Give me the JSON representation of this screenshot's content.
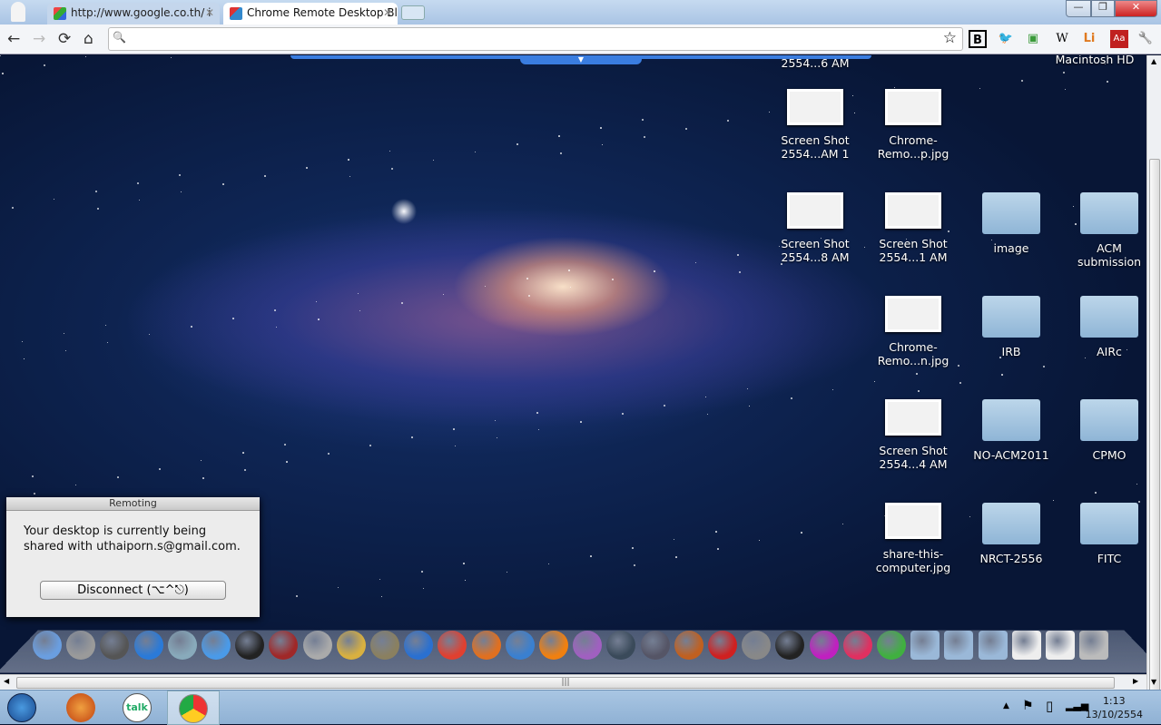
{
  "browser": {
    "tabs": [
      {
        "label": "http://www.google.co.th/ i",
        "favicon": "google-icon",
        "active": false
      },
      {
        "label": "Chrome Remote Desktop Bl",
        "favicon": "chrome-remote-desktop-icon",
        "active": true
      }
    ],
    "nav": {
      "back": "←",
      "forward": "→",
      "reload": "⟳",
      "home": "⌂"
    },
    "omnibox": {
      "value": "",
      "search_icon": "🔍",
      "star": "☆"
    },
    "extensions": [
      {
        "name": "b-icon",
        "glyph": "B",
        "color": "#000"
      },
      {
        "name": "twitter-icon",
        "glyph": "🐦",
        "color": "#3a8ad8"
      },
      {
        "name": "remote-desktop-icon",
        "glyph": "▣",
        "color": "#3a9a3a"
      },
      {
        "name": "wikipedia-icon",
        "glyph": "W",
        "color": "#222"
      },
      {
        "name": "li-icon",
        "glyph": "Li",
        "color": "#e07a20"
      },
      {
        "name": "dictionary-icon",
        "glyph": "Aa",
        "color": "#c02020"
      },
      {
        "name": "wrench-icon",
        "glyph": "🔧",
        "color": "#333"
      }
    ],
    "window_buttons": {
      "minimize": "—",
      "restore": "❐",
      "close": "✕"
    }
  },
  "desktop": {
    "remote_toggle": "▼",
    "partial_labels": {
      "top_screenshot": "2554...6 AM",
      "drive": "Macintosh HD"
    },
    "icons": [
      {
        "type": "thumb",
        "label1": "Screen Shot",
        "label2": "2554...AM 1",
        "col": 0,
        "row": 0
      },
      {
        "type": "thumb",
        "label1": "Chrome-",
        "label2": "Remo...p.jpg",
        "col": 1,
        "row": 0
      },
      {
        "type": "thumb",
        "label1": "Screen Shot",
        "label2": "2554...8 AM",
        "col": 0,
        "row": 1
      },
      {
        "type": "thumb",
        "label1": "Screen Shot",
        "label2": "2554...1 AM",
        "col": 1,
        "row": 1
      },
      {
        "type": "folder",
        "label1": "image",
        "label2": "",
        "col": 2,
        "row": 1
      },
      {
        "type": "folder",
        "label1": "ACM",
        "label2": "submission",
        "col": 3,
        "row": 1
      },
      {
        "type": "thumb",
        "label1": "Chrome-",
        "label2": "Remo...n.jpg",
        "col": 1,
        "row": 2
      },
      {
        "type": "folder",
        "label1": "IRB",
        "label2": "",
        "col": 2,
        "row": 2
      },
      {
        "type": "folder",
        "label1": "AIRc",
        "label2": "",
        "col": 3,
        "row": 2
      },
      {
        "type": "thumb",
        "label1": "Screen Shot",
        "label2": "2554...4 AM",
        "col": 1,
        "row": 3
      },
      {
        "type": "folder",
        "label1": "NO-ACM2011",
        "label2": "",
        "col": 2,
        "row": 3
      },
      {
        "type": "folder",
        "label1": "CPMO",
        "label2": "",
        "col": 3,
        "row": 3
      },
      {
        "type": "thumb",
        "label1": "share-this-",
        "label2": "computer.jpg",
        "col": 1,
        "row": 4
      },
      {
        "type": "folder",
        "label1": "NRCT-2556",
        "label2": "",
        "col": 2,
        "row": 4
      },
      {
        "type": "folder",
        "label1": "FITC",
        "label2": "",
        "col": 3,
        "row": 4
      }
    ],
    "dialog": {
      "title": "Remoting",
      "line1": "Your desktop is currently being",
      "line2": "shared with uthaiporn.s@gmail.com.",
      "button": "Disconnect (⌥^⎋)"
    },
    "dock": [
      {
        "name": "finder",
        "color": "#6a9ee0"
      },
      {
        "name": "launchpad",
        "color": "#9a9a9a"
      },
      {
        "name": "dashboard",
        "color": "#555"
      },
      {
        "name": "app-store",
        "color": "#2a7ad8"
      },
      {
        "name": "mail",
        "color": "#8ab"
      },
      {
        "name": "facetime",
        "color": "#4a9ae8"
      },
      {
        "name": "clock",
        "color": "#222"
      },
      {
        "name": "dictionary",
        "color": "#a02828"
      },
      {
        "name": "calculator",
        "color": "#aaa"
      },
      {
        "name": "textedit",
        "color": "#d8b040"
      },
      {
        "name": "gimp",
        "color": "#8a8060"
      },
      {
        "name": "itunes",
        "color": "#2a70d0"
      },
      {
        "name": "chrome",
        "color": "#e04030"
      },
      {
        "name": "firefox",
        "color": "#e07020"
      },
      {
        "name": "safari",
        "color": "#3a80d0"
      },
      {
        "name": "vlc",
        "color": "#f08010"
      },
      {
        "name": "picasa",
        "color": "#a060c0"
      },
      {
        "name": "lightroom",
        "color": "#3a4a5a"
      },
      {
        "name": "pen-tool",
        "color": "#556"
      },
      {
        "name": "keynote",
        "color": "#c06020"
      },
      {
        "name": "en-app",
        "color": "#d02020"
      },
      {
        "name": "system-preferences",
        "color": "#888"
      },
      {
        "name": "activity-monitor",
        "color": "#222"
      },
      {
        "name": "co-app",
        "color": "#c020c0"
      },
      {
        "name": "cs-app",
        "color": "#e03060"
      },
      {
        "name": "x-app",
        "color": "#40b040"
      },
      {
        "name": "applications-folder",
        "color": "#9ab8d8"
      },
      {
        "name": "documents-folder",
        "color": "#9ab8d8"
      },
      {
        "name": "downloads-folder",
        "color": "#9ab8d8"
      },
      {
        "name": "screenshot-doc",
        "color": "#eee"
      },
      {
        "name": "screenshot-doc-2",
        "color": "#eee"
      },
      {
        "name": "trash",
        "color": "#bbb"
      }
    ]
  },
  "taskbar": {
    "apps": [
      {
        "name": "start",
        "color": "#2a6ab8"
      },
      {
        "name": "firefox",
        "color": "#e07020"
      },
      {
        "name": "google-talk",
        "color": "#fff"
      },
      {
        "name": "chrome",
        "color": "#e04030"
      }
    ],
    "tray": {
      "arrow": "▲",
      "flag": "⚑",
      "battery": "▯",
      "signal": "▂▃▅"
    },
    "time": "1:13",
    "date": "13/10/2554"
  },
  "scrollbar": {
    "grip": "|||"
  }
}
